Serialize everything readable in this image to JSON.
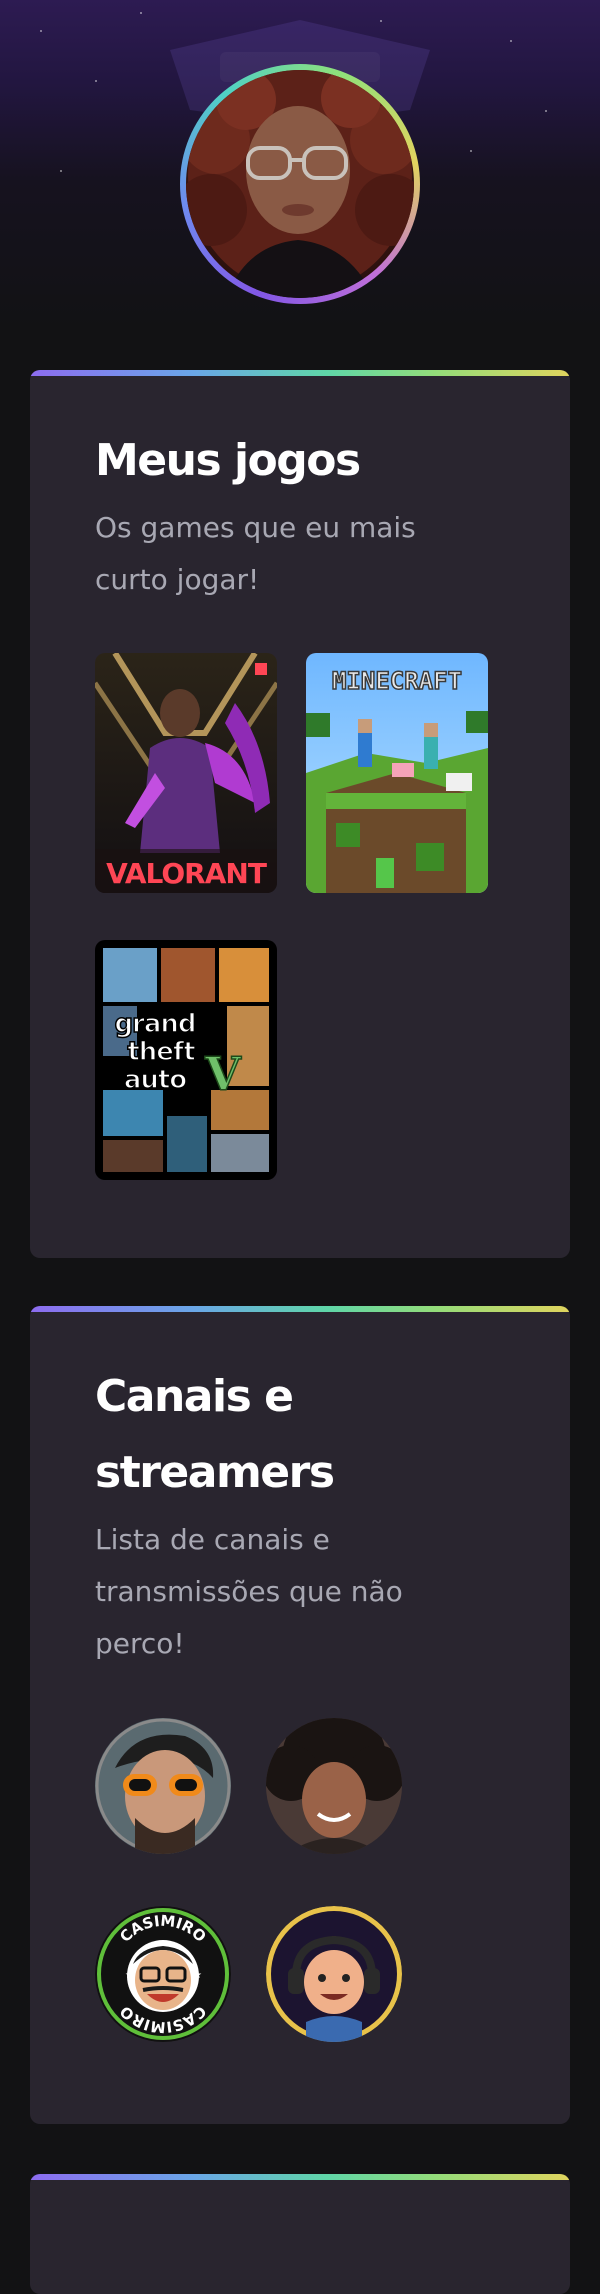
{
  "profile": {
    "avatar_alt": "Foto de perfil"
  },
  "games_section": {
    "title": "Meus jogos",
    "subtitle": "Os games que eu mais curto jogar!",
    "games": [
      {
        "name": "VALORANT",
        "icon": "valorant-cover"
      },
      {
        "name": "MINECRAFT",
        "icon": "minecraft-cover"
      },
      {
        "name": "grand theft auto V",
        "icon": "gta-v-cover"
      }
    ]
  },
  "streamers_section": {
    "title": "Canais e streamers",
    "subtitle": "Lista de canais e transmissões que não perco!",
    "streamers": [
      {
        "icon": "streamer-1-avatar"
      },
      {
        "icon": "streamer-2-avatar"
      },
      {
        "name": "CASIMIRO",
        "icon": "casimiro-logo"
      },
      {
        "icon": "streamer-4-avatar"
      }
    ]
  },
  "colors": {
    "background": "#121214",
    "card": "#29252f",
    "subtitle": "#a8a8b3",
    "accent_gradient": [
      "#8d6cf0",
      "#5fd6a8",
      "#e0d45e"
    ]
  }
}
